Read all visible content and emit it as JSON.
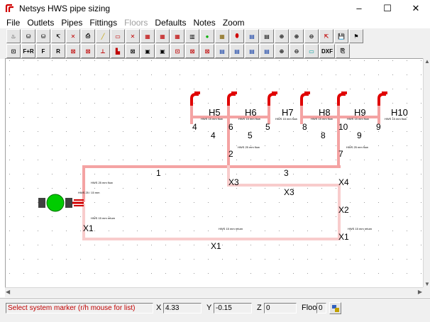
{
  "window": {
    "title": "Netsys HWS pipe sizing",
    "buttons": [
      "–",
      "☐",
      "✕"
    ]
  },
  "menu": [
    {
      "label": "File",
      "enabled": true
    },
    {
      "label": "Outlets",
      "enabled": true
    },
    {
      "label": "Pipes",
      "enabled": true
    },
    {
      "label": "Fittings",
      "enabled": true
    },
    {
      "label": "Floors",
      "enabled": false
    },
    {
      "label": "Defaults",
      "enabled": true
    },
    {
      "label": "Notes",
      "enabled": true
    },
    {
      "label": "Zoom",
      "enabled": true
    }
  ],
  "toolbar1": [
    "♨",
    "⛁",
    "⛁",
    "↸",
    "✕",
    "⎙",
    "╱",
    "▭",
    "✕",
    "▦",
    "▦",
    "▦",
    "▥",
    "●",
    "▦",
    "⬮",
    "▤",
    "▤",
    "⊕",
    "⊕",
    "⊖",
    "⇱",
    "💾",
    "⚑"
  ],
  "toolbar2": [
    "⊡",
    "F+R",
    "F",
    "R",
    "⊠",
    "⊠",
    "⊥",
    "▙",
    "⊠",
    "▣",
    "▣",
    "⊡",
    "⊠",
    "⊠",
    "▤",
    "▤",
    "▤",
    "▤",
    "⊕",
    "⊖",
    "▭",
    "DXF",
    "⎘"
  ],
  "colors": {
    "pipe_flow": "#f4a3a3",
    "pipe_return": "#f8cccc",
    "outlet": "#e00000",
    "pump": "#00cc00",
    "status_text": "#c00000"
  },
  "diagram": {
    "outlets": [
      "H5",
      "H6",
      "H7",
      "H8",
      "H9",
      "H10"
    ],
    "node_labels": [
      "4",
      "6",
      "5",
      "8",
      "10",
      "9",
      "4",
      "5",
      "8",
      "9",
      "2",
      "7",
      "1",
      "3",
      "X3",
      "X4",
      "X3",
      "X2",
      "X1",
      "X1",
      "X1"
    ],
    "pipe_notes": {
      "outlet_flow": "HWS 15 mm flow",
      "flow_25": "HWS 25 mm flow",
      "pump_label": "HWS 25 / 15 mm",
      "return_15": "HWS 15 mm return"
    }
  },
  "status": {
    "message": "Select system marker (r/h mouse for list)",
    "x_label": "X",
    "x_value": "4.33",
    "y_label": "Y",
    "y_value": "-0.15",
    "z_label": "Z",
    "z_value": "0",
    "floor_label": "Floor",
    "floor_value": "0"
  }
}
